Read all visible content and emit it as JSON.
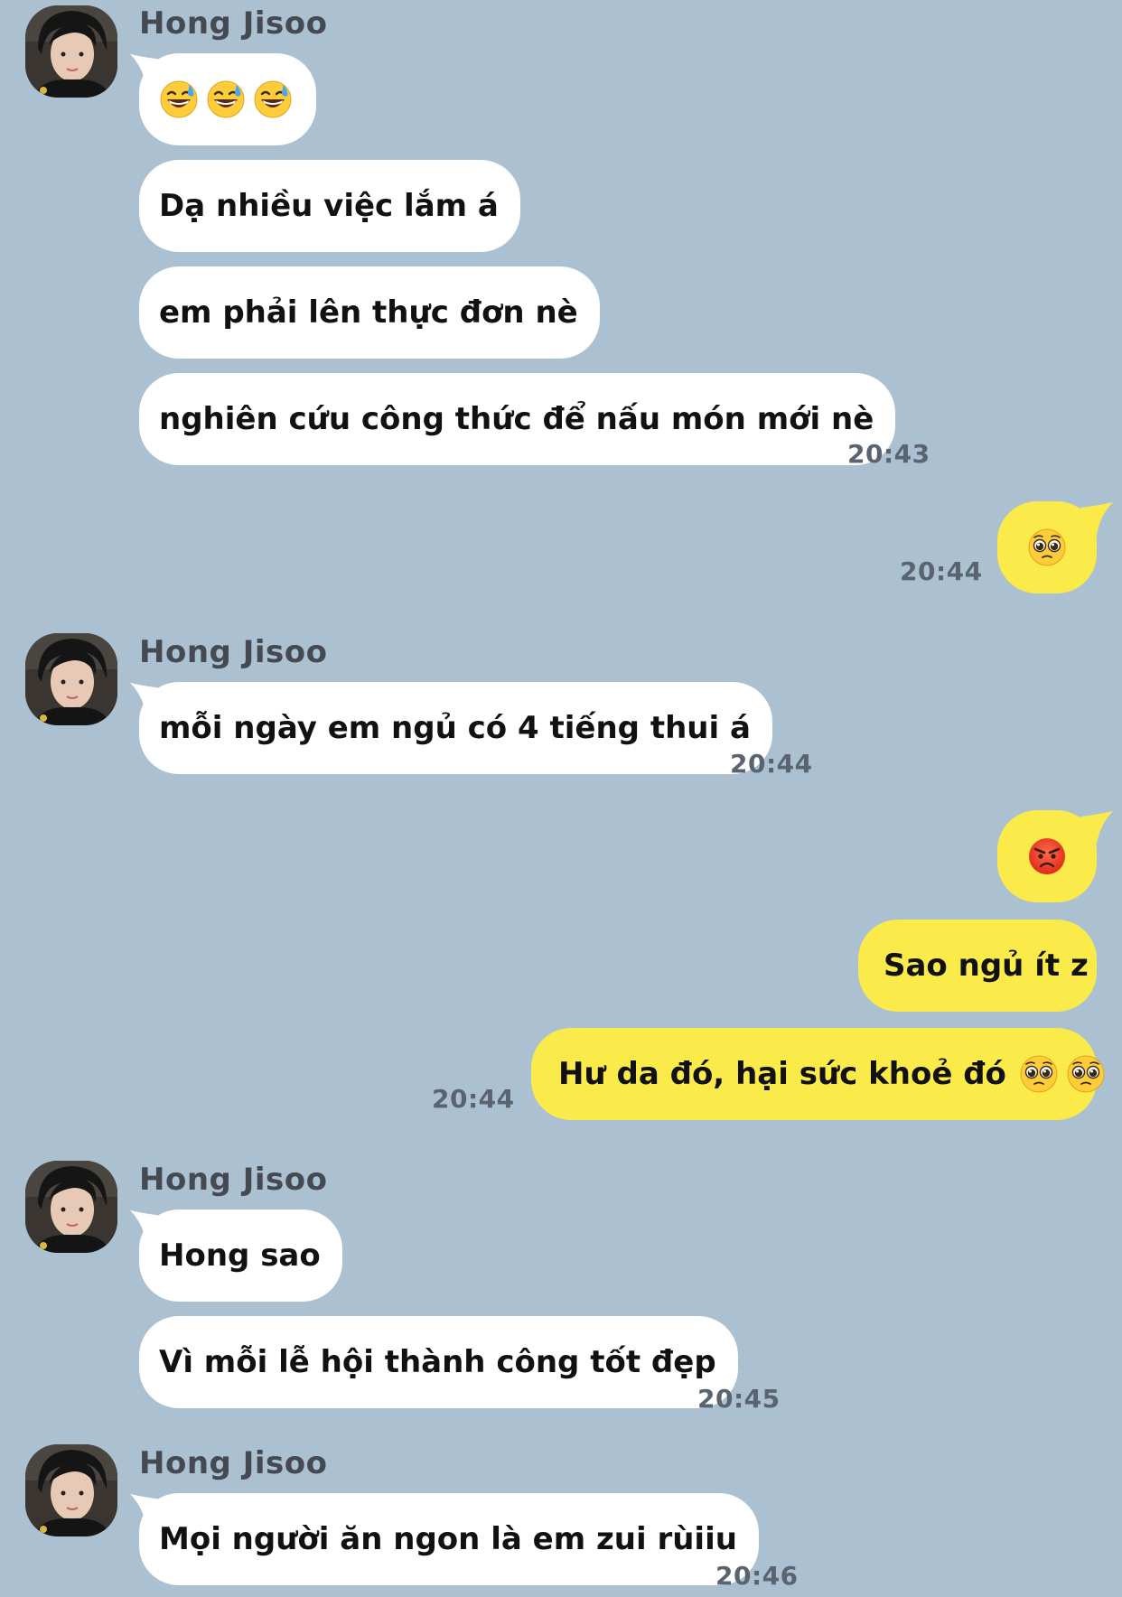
{
  "sender_name": "Hong Jisoo",
  "messages": {
    "m1": {
      "emojis": [
        "grinning-sweat-icon",
        "grinning-sweat-icon",
        "grinning-sweat-icon"
      ]
    },
    "m2": {
      "text": "Dạ nhiều việc lắm á"
    },
    "m3": {
      "text": "em phải lên thực đơn nè"
    },
    "m4": {
      "text": "nghiên cứu công thức để nấu món mới nè",
      "time": "20:43"
    },
    "m5": {
      "emoji": "pleading-face-icon",
      "time": "20:44"
    },
    "m6": {
      "text": "mỗi ngày em ngủ có 4 tiếng thui á",
      "time": "20:44"
    },
    "m7": {
      "emoji": "angry-face-icon"
    },
    "m8": {
      "text": "Sao ngủ ít z"
    },
    "m9": {
      "text": "Hư da đó, hại sức khoẻ đó",
      "emojis": [
        "pleading-face-icon",
        "pleading-face-icon"
      ],
      "time": "20:44"
    },
    "m10": {
      "text": "Hong sao"
    },
    "m11": {
      "text": "Vì mỗi lễ hội thành công tốt đẹp",
      "time": "20:45"
    },
    "m12": {
      "text": "Mọi người ăn ngon là em zui rùiiu",
      "time": "20:46"
    }
  },
  "colors": {
    "background": "#abc1d1",
    "incoming_bubble": "#ffffff",
    "outgoing_bubble": "#fbeb4a"
  }
}
